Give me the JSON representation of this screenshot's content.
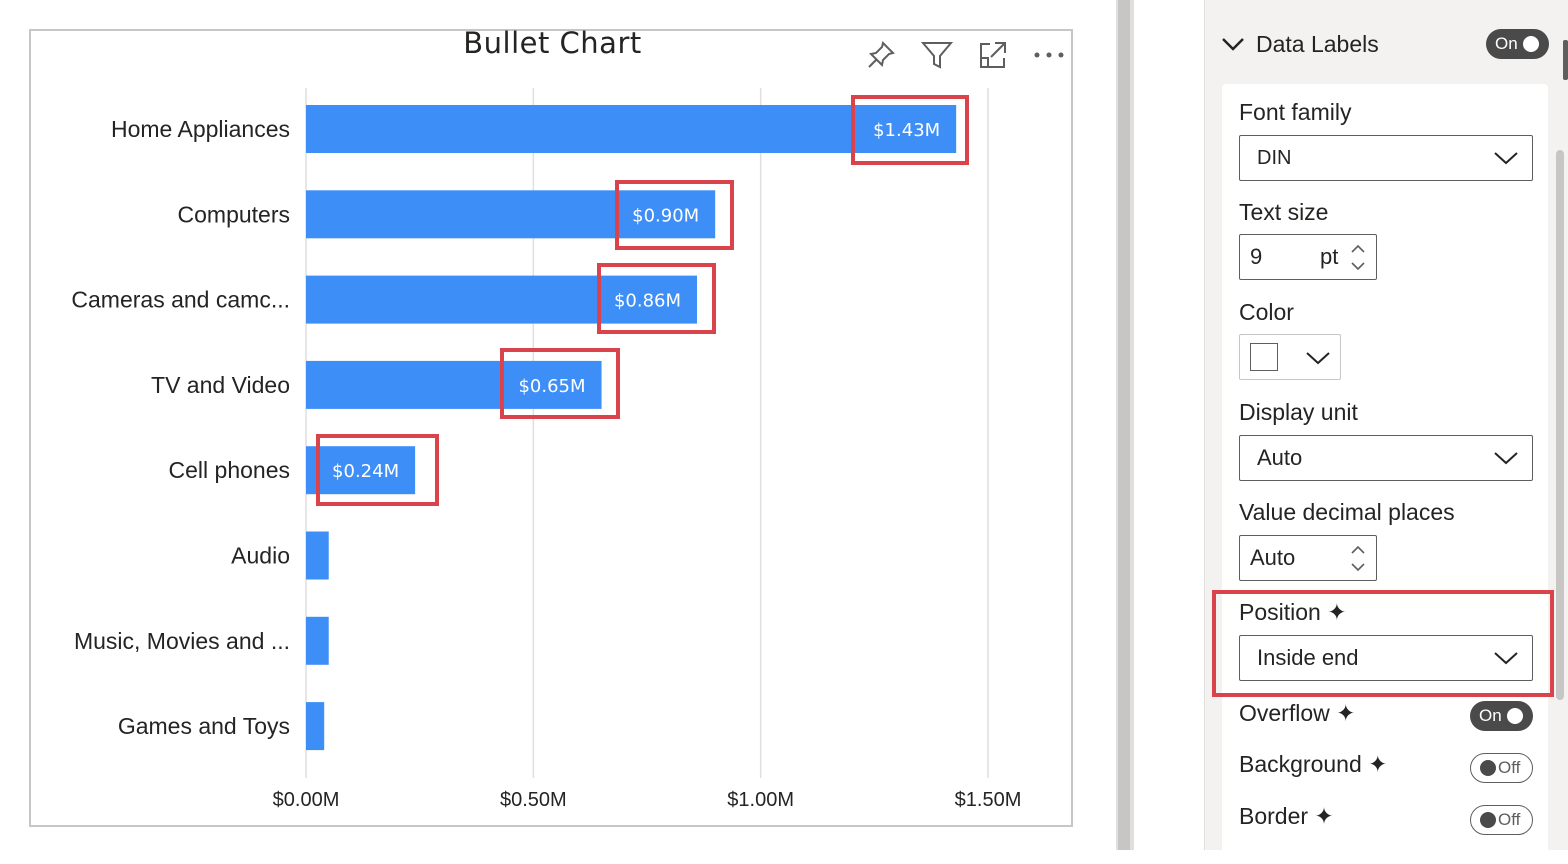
{
  "visual": {
    "title": "Bullet Chart",
    "header_icons": [
      "pin-icon",
      "filter-icon",
      "focus-mode-icon",
      "more-options-icon"
    ]
  },
  "chart_data": {
    "type": "bar",
    "orientation": "horizontal",
    "categories": [
      "Home Appliances",
      "Computers",
      "Cameras and camc...",
      "TV and Video",
      "Cell phones",
      "Audio",
      "Music, Movies and ...",
      "Games and Toys"
    ],
    "values": [
      1.43,
      0.9,
      0.86,
      0.65,
      0.24,
      0.05,
      0.05,
      0.04
    ],
    "data_labels": [
      "$1.43M",
      "$0.90M",
      "$0.86M",
      "$0.65M",
      "$0.24M",
      "",
      "",
      ""
    ],
    "x_ticks": [
      0,
      0.5,
      1.0,
      1.5
    ],
    "x_tick_labels": [
      "$0.00M",
      "$0.50M",
      "$1.00M",
      "$1.50M"
    ],
    "xlim": [
      0,
      1.5
    ],
    "grid": true,
    "bar_color": "#3e8ef7",
    "title": "Bullet Chart"
  },
  "format_pane": {
    "section_title": "Data Labels",
    "section_toggle": "On",
    "font_family_label": "Font family",
    "font_family_value": "DIN",
    "text_size_label": "Text size",
    "text_size_value": "9",
    "text_size_unit": "pt",
    "color_label": "Color",
    "color_value": "#ffffff",
    "display_unit_label": "Display unit",
    "display_unit_value": "Auto",
    "decimal_label": "Value decimal places",
    "decimal_value": "Auto",
    "position_label": "Position ✦",
    "position_value": "Inside end",
    "overflow_label": "Overflow ✦",
    "overflow_toggle": "On",
    "background_label": "Background ✦",
    "background_toggle": "Off",
    "border_label": "Border ✦",
    "border_toggle": "Off"
  },
  "colors": {
    "highlight": "#d9434b",
    "bar": "#3e8ef7"
  }
}
